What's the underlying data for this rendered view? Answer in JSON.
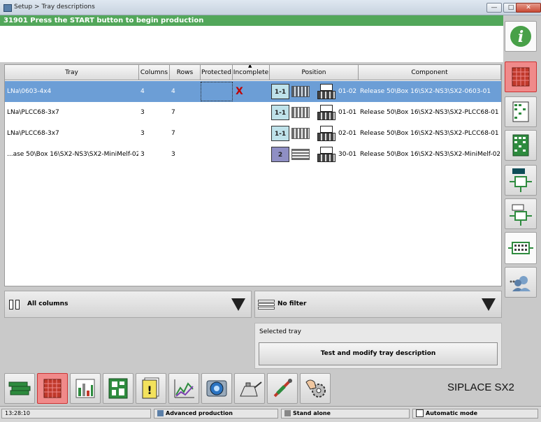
{
  "window": {
    "title": "Setup > Tray descriptions"
  },
  "message": {
    "text": "31901 Press the START button to begin production",
    "color": "#52a75a"
  },
  "table": {
    "headers": [
      "Tray",
      "Columns",
      "Rows",
      "Protected",
      "Incomplete",
      "Position",
      "Component"
    ],
    "rows": [
      {
        "tray": "LNa\\0603-4x4",
        "columns": "4",
        "rows": "4",
        "incomplete": "X",
        "pos_label": "1-1",
        "position": "01-02",
        "component": "Release 50\\Box 16\\SX2-NS3\\SX2-0603-01",
        "selected": true
      },
      {
        "tray": "LNa\\PLCC68-3x7",
        "columns": "3",
        "rows": "7",
        "incomplete": "",
        "pos_label": "1-1",
        "position": "01-01",
        "component": "Release 50\\Box 16\\SX2-NS3\\SX2-PLCC68-01",
        "selected": false
      },
      {
        "tray": "LNa\\PLCC68-3x7",
        "columns": "3",
        "rows": "7",
        "incomplete": "",
        "pos_label": "1-1",
        "position": "02-01",
        "component": "Release 50\\Box 16\\SX2-NS3\\SX2-PLCC68-01",
        "selected": false
      },
      {
        "tray": "...ase 50\\Box 16\\SX2-NS3\\SX2-MiniMelf-02",
        "columns": "3",
        "rows": "3",
        "incomplete": "",
        "pos_label": "2",
        "position": "30-01",
        "component": "Release 50\\Box 16\\SX2-NS3\\SX2-MiniMelf-02",
        "selected": false
      }
    ]
  },
  "filters": {
    "columns": "All columns",
    "filter": "No filter"
  },
  "selected_tray": {
    "caption": "Selected tray",
    "button": "Test and modify tray description"
  },
  "brand": "SIPLACE SX2",
  "status": {
    "time": "13:28:10",
    "mode1": "Advanced production",
    "mode2": "Stand alone",
    "mode3": "Automatic mode"
  },
  "icons": {
    "sidebar": [
      "info-icon",
      "tray-matrix-icon",
      "feeder-table-icon",
      "component-list-icon",
      "component-place-icon",
      "component-check-icon",
      "tray-grid-icon",
      "user-settings-icon"
    ],
    "toolbar": [
      "component-stack-icon",
      "tray-matrix-icon",
      "bar-chart-icon",
      "board-layout-icon",
      "warning-document-icon",
      "line-chart-icon",
      "camera-icon",
      "oil-can-icon",
      "tool-icon",
      "gear-hand-icon"
    ]
  },
  "colors": {
    "selected_row": "#6c9ed6",
    "active_tab": "#f08a8a",
    "error_x": "#c00000"
  }
}
